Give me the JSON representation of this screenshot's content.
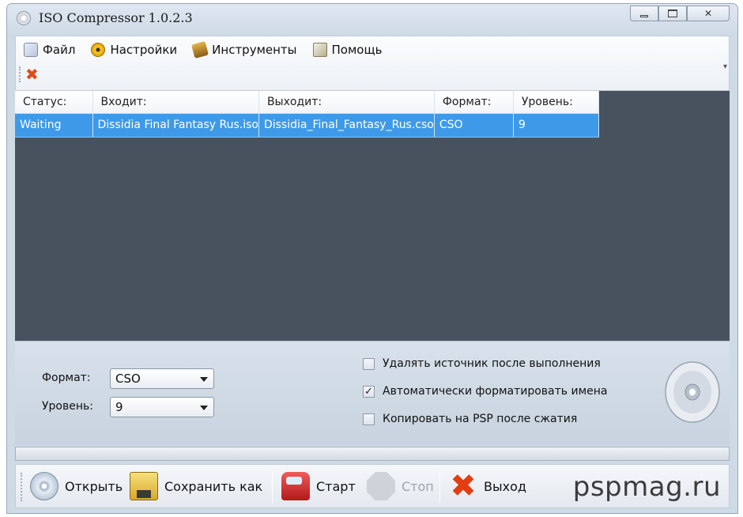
{
  "window": {
    "title": "ISO Compressor 1.0.2.3"
  },
  "menu": [
    {
      "label": "Файл",
      "icon": "file-icon"
    },
    {
      "label": "Настройки",
      "icon": "settings-icon"
    },
    {
      "label": "Инструменты",
      "icon": "tools-icon"
    },
    {
      "label": "Помощь",
      "icon": "help-icon"
    }
  ],
  "toolbar": {
    "remove_icon": "remove-x-icon"
  },
  "table": {
    "headers": [
      "Статус:",
      "Входит:",
      "Выходит:",
      "Формат:",
      "Уровень:"
    ],
    "rows": [
      [
        "Waiting",
        "Dissidia Final Fantasy Rus.iso",
        "Dissidia_Final_Fantasy_Rus.cso",
        "CSO",
        "9"
      ]
    ]
  },
  "options": {
    "format_label": "Формат:",
    "format_value": "CSO",
    "level_label": "Уровень:",
    "level_value": "9",
    "checkboxes": [
      {
        "label": "Удалять источник после выполнения",
        "checked": false
      },
      {
        "label": "Автоматически форматировать имена",
        "checked": true
      },
      {
        "label": "Копировать на PSP после сжатия",
        "checked": false
      }
    ]
  },
  "buttons": {
    "open": "Открыть",
    "save_as": "Сохранить как",
    "start": "Старт",
    "stop": "Стоп",
    "exit": "Выход"
  },
  "watermark": "pspmag.ru",
  "colors": {
    "selection": "#3e9ae8",
    "list_background": "#47525e",
    "exit_accent": "#e33d12"
  }
}
